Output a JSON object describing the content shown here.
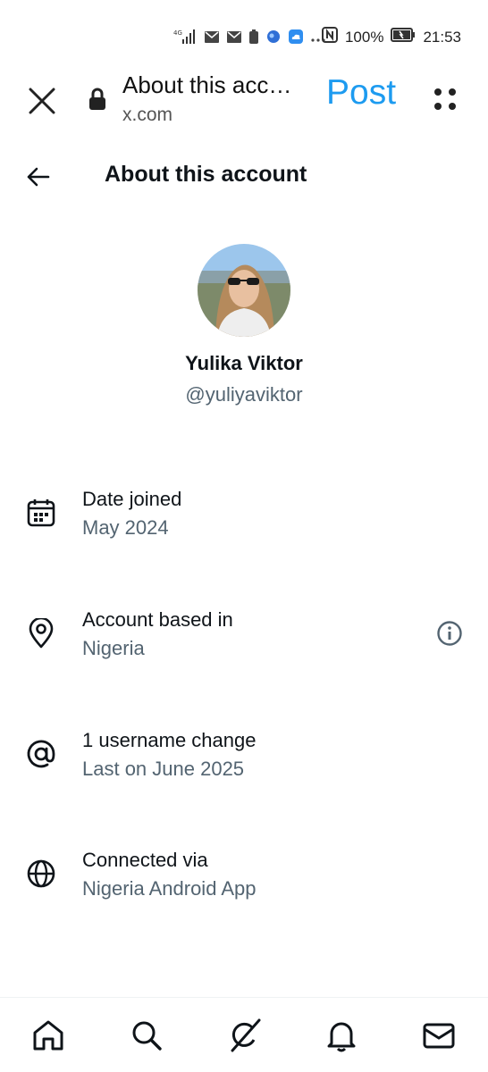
{
  "status_bar": {
    "network": "4G",
    "battery_percent": "100%",
    "time": "21:53"
  },
  "browser": {
    "page_title": "About this acc…",
    "host": "x.com",
    "post_label": "Post"
  },
  "header": {
    "title": "About this account"
  },
  "profile": {
    "display_name": "Yulika Viktor",
    "handle": "@yuliyaviktor"
  },
  "details": [
    {
      "icon": "calendar-icon",
      "title": "Date joined",
      "value": "May 2024"
    },
    {
      "icon": "location-pin-icon",
      "title": "Account based in",
      "value": "Nigeria"
    },
    {
      "icon": "at-sign-icon",
      "title": "1 username change",
      "value": "Last on June 2025"
    },
    {
      "icon": "globe-icon",
      "title": "Connected via",
      "value": "Nigeria Android App"
    }
  ],
  "colors": {
    "accent": "#1d9bf0",
    "text_primary": "#0f1419",
    "text_secondary": "#536471"
  },
  "bottom_nav": [
    "home-icon",
    "search-icon",
    "grok-icon",
    "notifications-icon",
    "messages-icon"
  ]
}
